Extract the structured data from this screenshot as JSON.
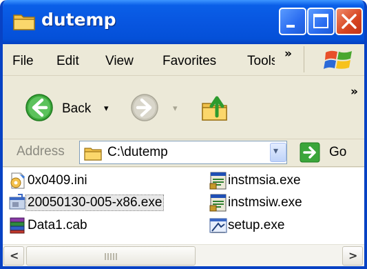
{
  "window": {
    "title": "dutemp",
    "icon": "folder-icon"
  },
  "title_buttons": [
    "minimize-icon",
    "maximize-icon",
    "close-icon"
  ],
  "menu": {
    "items": [
      "File",
      "Edit",
      "View",
      "Favorites",
      "Tools"
    ],
    "overflow": "»"
  },
  "toolbar": {
    "back_label": "Back",
    "dropdown_glyph": "▾",
    "overflow": "»"
  },
  "address": {
    "label": "Address",
    "value": "C:\\dutemp",
    "go_label": "Go"
  },
  "files": [
    {
      "name": "0x0409.ini",
      "icon": "ini-settings-icon",
      "selected": false
    },
    {
      "name": "20050130-005-x86.exe",
      "icon": "exe-installer-icon",
      "selected": true
    },
    {
      "name": "Data1.cab",
      "icon": "cab-archive-icon",
      "selected": false
    },
    {
      "name": "instmsia.exe",
      "icon": "msi-installer-icon",
      "selected": false
    },
    {
      "name": "instmsiw.exe",
      "icon": "msi-installer-icon",
      "selected": false
    },
    {
      "name": "setup.exe",
      "icon": "setup-icon",
      "selected": false
    }
  ],
  "scrollbar": {
    "left_glyph": "<",
    "right_glyph": ">"
  },
  "colors": {
    "titlebar_blue": "#0856e0",
    "close_red": "#d64420",
    "back_green": "#3aa53a",
    "selection_gray": "#e8e8e8"
  }
}
